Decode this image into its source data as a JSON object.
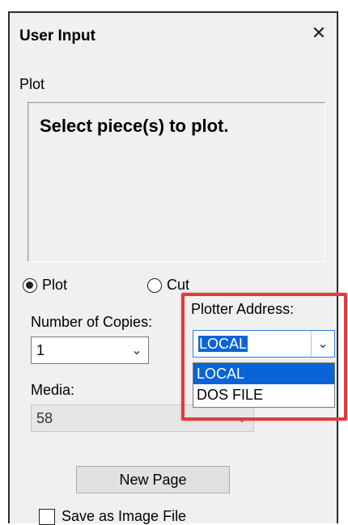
{
  "window": {
    "title": "User Input",
    "close_glyph": "✕"
  },
  "plot_group": {
    "label": "Plot",
    "message": "Select piece(s) to plot."
  },
  "mode": {
    "options": [
      {
        "label": "Plot",
        "checked": true
      },
      {
        "label": "Cut",
        "checked": false
      }
    ]
  },
  "copies": {
    "label": "Number of Copies:",
    "value": "1",
    "arrow_icon": "chevron-down-icon"
  },
  "plotter_address": {
    "label": "Plotter Address:",
    "value": "LOCAL",
    "arrow_icon": "chevron-down-icon",
    "dropdown_open": true,
    "options": [
      "LOCAL",
      "DOS FILE"
    ],
    "highlighted_option": "LOCAL"
  },
  "media": {
    "label": "Media:",
    "value": "58",
    "disabled": true,
    "arrow_icon": "chevron-down-icon"
  },
  "new_page_button": "New Page",
  "save_image": {
    "label": "Save as Image File",
    "checked": false
  },
  "colors": {
    "highlight_border": "#e03c3c",
    "selection_blue": "#0a64d6",
    "panel_bg": "#f0f0f0"
  }
}
